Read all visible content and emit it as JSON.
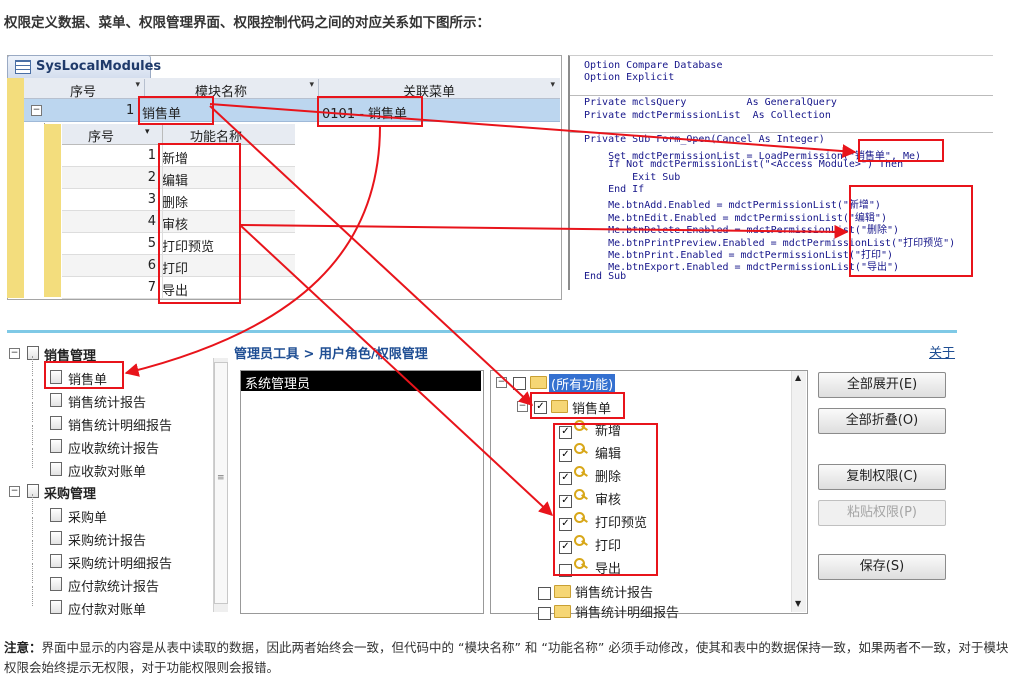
{
  "heading": "权限定义数据、菜单、权限管理界面、权限控制代码之间的对应关系如下图所示：",
  "datasheet": {
    "tab_title": "SysLocalModules",
    "columns": [
      "序号",
      "模块名称",
      "关联菜单"
    ],
    "main_row": {
      "num": "1",
      "module": "销售单",
      "menu": "0101 - 销售单"
    },
    "sub_columns": [
      "序号",
      "功能名称"
    ],
    "sub_rows": [
      {
        "num": "1",
        "name": "新增"
      },
      {
        "num": "2",
        "name": "编辑"
      },
      {
        "num": "3",
        "name": "删除"
      },
      {
        "num": "4",
        "name": "审核"
      },
      {
        "num": "5",
        "name": "打印预览"
      },
      {
        "num": "6",
        "name": "打印"
      },
      {
        "num": "7",
        "name": "导出"
      }
    ]
  },
  "code": {
    "lines": [
      "Option Compare Database",
      "Option Explicit",
      "",
      "Private mclsQuery          As GeneralQuery",
      "Private mdctPermissionList  As Collection",
      "",
      "Private Sub Form_Open(Cancel As Integer)",
      "    Set mdctPermissionList = LoadPermission(\"销售单\", Me)",
      "    If Not mdctPermissionList(\"<Access Module>\") Then",
      "        Exit Sub",
      "    End If",
      "    Me.btnAdd.Enabled = mdctPermissionList(\"新增\")",
      "    Me.btnEdit.Enabled = mdctPermissionList(\"编辑\")",
      "    Me.btnDelete.Enabled = mdctPermissionList(\"删除\")",
      "    Me.btnPrintPreview.Enabled = mdctPermissionList(\"打印预览\")",
      "    Me.btnPrint.Enabled = mdctPermissionList(\"打印\")",
      "    Me.btnExport.Enabled = mdctPermissionList(\"导出\")",
      "End Sub"
    ]
  },
  "menu_tree": {
    "groups": [
      {
        "label": "销售管理",
        "items": [
          "销售单",
          "销售统计报告",
          "销售统计明细报告",
          "应收款统计报告",
          "应收款对账单"
        ]
      },
      {
        "label": "采购管理",
        "items": [
          "采购单",
          "采购统计报告",
          "采购统计明细报告",
          "应付款统计报告",
          "应付款对账单"
        ]
      }
    ]
  },
  "admin": {
    "breadcrumb": "管理员工具 > 用户角色/权限管理",
    "about_link": "关于",
    "roles": [
      "系统管理员"
    ],
    "perm_root": "(所有功能)",
    "perm_module": "销售单",
    "perm_items": [
      {
        "label": "新增",
        "checked": true
      },
      {
        "label": "编辑",
        "checked": true
      },
      {
        "label": "删除",
        "checked": true
      },
      {
        "label": "审核",
        "checked": true
      },
      {
        "label": "打印预览",
        "checked": true
      },
      {
        "label": "打印",
        "checked": true
      },
      {
        "label": "导出",
        "checked": false
      }
    ],
    "perm_more": [
      "销售统计报告",
      "销售统计明细报告"
    ],
    "buttons": [
      {
        "label": "全部展开(E)",
        "enabled": true
      },
      {
        "label": "全部折叠(O)",
        "enabled": true
      },
      {
        "label": "复制权限(C)",
        "enabled": true
      },
      {
        "label": "粘贴权限(P)",
        "enabled": false
      },
      {
        "label": "保存(S)",
        "enabled": true
      }
    ],
    "check_mark": "✓"
  },
  "note": {
    "label": "注意：",
    "text": "界面中显示的内容是从表中读取的数据，因此两者始终会一致，但代码中的 “模块名称” 和 “功能名称” 必须手动修改，使其和表中的数据保持一致，如果两者不一致，对于模块权限会始终提示无权限，对于功能权限则会报错。"
  },
  "colors": {
    "annotation": "#e8141b",
    "selection_row": "#bcd6ef",
    "record_selector": "#f3dd7d",
    "link": "#1f4e93"
  }
}
